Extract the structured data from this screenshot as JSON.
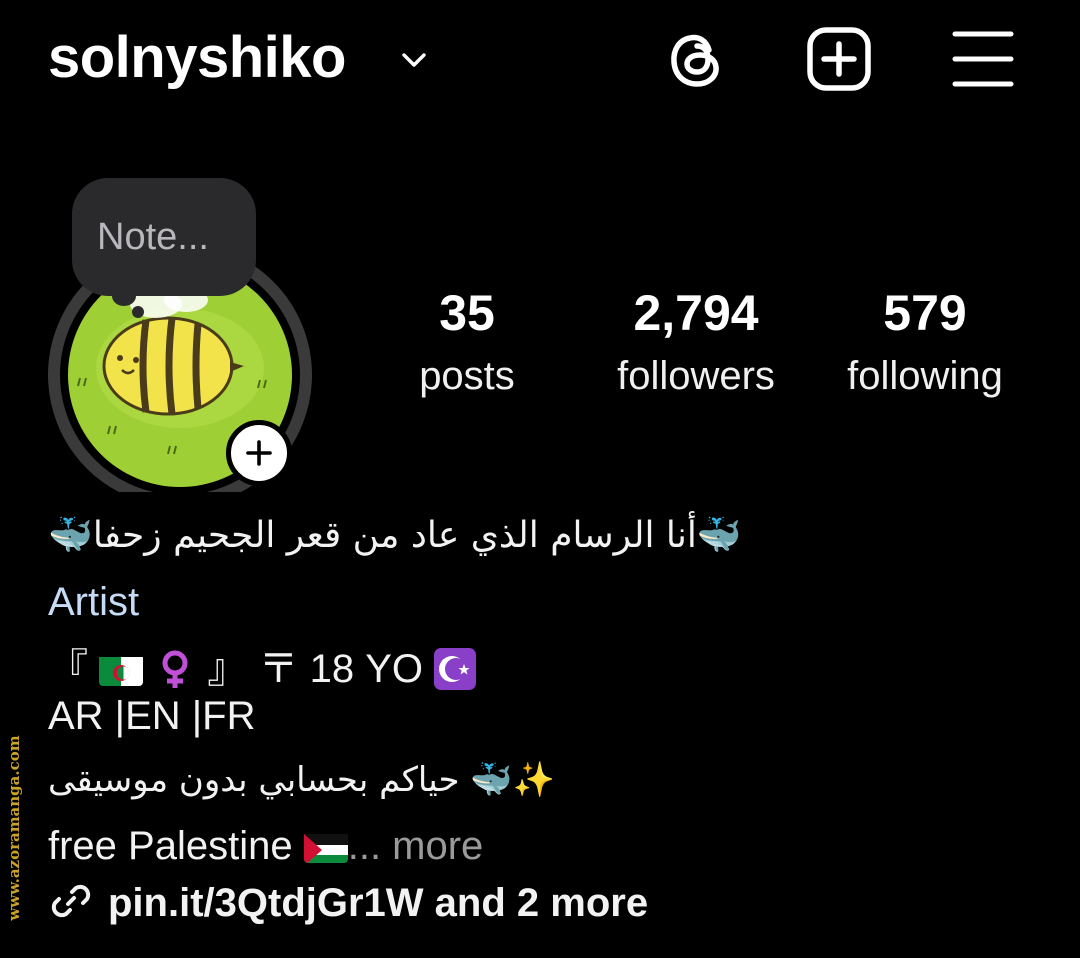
{
  "header": {
    "username": "solnyshiko",
    "chevron_icon": "chevron-down-icon",
    "threads_icon": "threads-icon",
    "new_post_icon": "plus-square-icon",
    "menu_icon": "hamburger-menu-icon"
  },
  "note": {
    "placeholder": "Note..."
  },
  "stats": {
    "posts": {
      "count": "35",
      "label": "posts"
    },
    "followers": {
      "count": "2,794",
      "label": "followers"
    },
    "following": {
      "count": "579",
      "label": "following"
    }
  },
  "bio": {
    "line1": "🐳أنا الرسام الذي عاد من قعر الجحيم زحفا🐳",
    "category": "Artist",
    "line3_open": "『",
    "line3_close": "』 〒 18 YO",
    "line4": "AR |EN |FR",
    "line5": "حياكم بحسابي بدون موسيقى 🐳✨",
    "line6": "free Palestine",
    "line6_more": "... more",
    "link": "pin.it/3QtdjGr1W and 2 more"
  },
  "watermark": "www.azoramanga.com",
  "colors": {
    "background": "#000000",
    "note_bubble": "#2a2a2c",
    "category": "#c6dbf5",
    "muted": "#9a9a9a",
    "avatar_bg": "#9ed036",
    "bee_yellow": "#f3e34a"
  }
}
